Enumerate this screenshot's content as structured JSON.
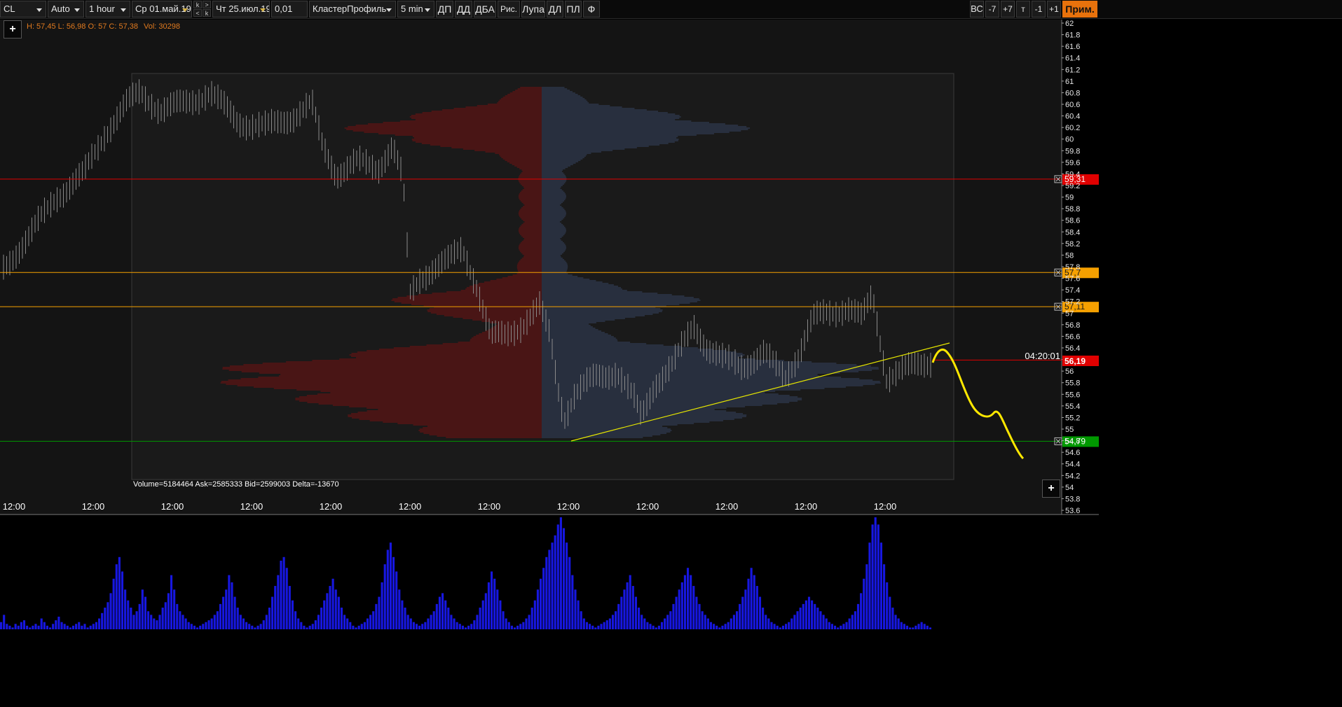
{
  "toolbar": {
    "symbol": "CL",
    "scale_mode": "Auto",
    "timeframe": "1 hour",
    "date_from": "Ср 01.май.19",
    "stepper_k1": "k",
    "stepper_gt": ">",
    "stepper_lt": "<",
    "stepper_k2": "k",
    "date_to": "Чт 25.июл.19",
    "tick_size": "0,01",
    "chart_type": "КластерПрофиль",
    "cluster_period": "5 min",
    "btn_dp": "ДП",
    "btn_dd": "ДД",
    "btn_dba": "ДБА",
    "btn_ris": "Рис.",
    "btn_lupa": "Лупа",
    "btn_dl": "ДЛ",
    "btn_pl": "ПЛ",
    "btn_f": "Ф",
    "btn_vs": "ВС",
    "btn_m7": "-7",
    "btn_p7": "+7",
    "btn_t": "т",
    "btn_m1": "-1",
    "btn_p1": "+1",
    "btn_prim": "Прим."
  },
  "info": {
    "ohlc": "H: 57,45  L: 56,98  O: 57  C: 57,38",
    "vol": "Vol: 30298",
    "profile_stats": "Volume=5184464  Ask=2585333  Bid=2599003  Delta=-13670"
  },
  "chart_data": {
    "type": "candlestick",
    "instrument": "CL",
    "timeframe": "1 hour",
    "y_axis": {
      "min": 53.6,
      "max": 62,
      "ticks": [
        "62",
        "61.8",
        "61.6",
        "61.4",
        "61.2",
        "61",
        "60.8",
        "60.6",
        "60.4",
        "60.2",
        "60",
        "59.8",
        "59.6",
        "59.4",
        "59.2",
        "59",
        "58.8",
        "58.6",
        "58.4",
        "58.2",
        "58",
        "57.8",
        "57.6",
        "57.4",
        "57.2",
        "57",
        "56.8",
        "56.6",
        "56.4",
        "56.2",
        "56",
        "55.8",
        "55.6",
        "55.4",
        "55.2",
        "55",
        "54.8",
        "54.6",
        "54.4",
        "54.2",
        "54",
        "53.8",
        "53.6"
      ]
    },
    "x_axis": {
      "ticks": [
        "12:00",
        "12:00",
        "12:00",
        "12:00",
        "12:00",
        "12:00",
        "12:00",
        "12:00",
        "12:00",
        "12:00",
        "12:00",
        "12:00"
      ]
    },
    "price_levels": [
      {
        "value": 59.31,
        "label": "59,31",
        "color": "#e00000"
      },
      {
        "value": 57.7,
        "label": "57,7",
        "color": "#f5a000"
      },
      {
        "value": 57.11,
        "label": "57,11",
        "color": "#f5a000"
      },
      {
        "value": 54.79,
        "label": "54,79",
        "color": "#009900"
      }
    ],
    "current_price": {
      "value": 56.19,
      "label": "56,19",
      "color": "#e00000"
    },
    "candle_countdown": "04:20:01",
    "price_path": [
      [
        0,
        57.7
      ],
      [
        40,
        58.3
      ],
      [
        80,
        59.0
      ],
      [
        120,
        59.4
      ],
      [
        150,
        60.1
      ],
      [
        180,
        60.6
      ],
      [
        200,
        60.8
      ],
      [
        230,
        60.5
      ],
      [
        260,
        60.6
      ],
      [
        300,
        60.8
      ],
      [
        340,
        60.3
      ],
      [
        380,
        60.2
      ],
      [
        420,
        60.4
      ],
      [
        445,
        60.6
      ],
      [
        460,
        59.9
      ],
      [
        480,
        59.4
      ],
      [
        510,
        59.6
      ],
      [
        540,
        59.5
      ],
      [
        560,
        59.9
      ],
      [
        575,
        59.3
      ],
      [
        585,
        57.3
      ],
      [
        600,
        57.6
      ],
      [
        620,
        57.8
      ],
      [
        640,
        57.9
      ],
      [
        660,
        58.1
      ],
      [
        680,
        57.5
      ],
      [
        700,
        56.6
      ],
      [
        720,
        56.6
      ],
      [
        745,
        56.8
      ],
      [
        770,
        57.1
      ],
      [
        785,
        56.6
      ],
      [
        795,
        55.8
      ],
      [
        805,
        55.2
      ],
      [
        820,
        55.6
      ],
      [
        850,
        55.9
      ],
      [
        880,
        56.0
      ],
      [
        905,
        55.5
      ],
      [
        915,
        55.2
      ],
      [
        935,
        55.8
      ],
      [
        960,
        56.1
      ],
      [
        990,
        56.8
      ],
      [
        1010,
        56.4
      ],
      [
        1030,
        56.2
      ],
      [
        1060,
        56.1
      ],
      [
        1090,
        56.3
      ],
      [
        1120,
        55.9
      ],
      [
        1140,
        56.3
      ],
      [
        1160,
        56.9
      ],
      [
        1180,
        57.0
      ],
      [
        1210,
        57.1
      ],
      [
        1230,
        56.9
      ],
      [
        1245,
        57.3
      ],
      [
        1255,
        56.6
      ],
      [
        1265,
        55.9
      ],
      [
        1285,
        56.0
      ],
      [
        1310,
        56.1
      ],
      [
        1330,
        56.19
      ]
    ],
    "volume_bars": [
      4,
      8,
      3,
      2,
      1,
      3,
      2,
      4,
      5,
      2,
      1,
      2,
      3,
      2,
      6,
      4,
      2,
      1,
      3,
      5,
      7,
      4,
      3,
      2,
      1,
      2,
      3,
      4,
      2,
      3,
      1,
      2,
      3,
      4,
      6,
      9,
      12,
      15,
      20,
      28,
      36,
      40,
      32,
      22,
      16,
      12,
      8,
      10,
      14,
      22,
      18,
      10,
      8,
      6,
      5,
      8,
      12,
      15,
      20,
      30,
      22,
      14,
      10,
      8,
      6,
      4,
      3,
      2,
      1,
      2,
      3,
      4,
      5,
      6,
      8,
      10,
      14,
      18,
      22,
      30,
      26,
      18,
      12,
      8,
      6,
      4,
      3,
      2,
      1,
      2,
      3,
      5,
      8,
      12,
      18,
      24,
      30,
      38,
      40,
      34,
      24,
      16,
      10,
      6,
      4,
      2,
      1,
      2,
      3,
      5,
      8,
      12,
      16,
      20,
      24,
      28,
      22,
      18,
      12,
      8,
      6,
      4,
      2,
      1,
      2,
      3,
      4,
      6,
      8,
      10,
      14,
      18,
      26,
      36,
      44,
      48,
      40,
      32,
      22,
      16,
      12,
      8,
      6,
      4,
      3,
      2,
      3,
      4,
      6,
      8,
      10,
      14,
      18,
      20,
      16,
      12,
      8,
      6,
      4,
      3,
      2,
      1,
      2,
      3,
      5,
      8,
      12,
      16,
      20,
      26,
      32,
      28,
      22,
      16,
      10,
      6,
      4,
      2,
      1,
      2,
      3,
      4,
      6,
      8,
      12,
      16,
      22,
      28,
      34,
      40,
      44,
      48,
      52,
      58,
      62,
      56,
      48,
      40,
      30,
      22,
      16,
      10,
      6,
      4,
      3,
      2,
      1,
      2,
      3,
      4,
      5,
      6,
      8,
      10,
      14,
      18,
      22,
      26,
      30,
      24,
      18,
      12,
      8,
      6,
      4,
      3,
      2,
      1,
      2,
      4,
      6,
      8,
      10,
      14,
      18,
      22,
      26,
      30,
      34,
      30,
      24,
      18,
      14,
      10,
      8,
      6,
      4,
      3,
      2,
      1,
      2,
      3,
      4,
      6,
      8,
      10,
      14,
      18,
      22,
      28,
      34,
      30,
      24,
      18,
      12,
      8,
      6,
      4,
      3,
      2,
      1,
      2,
      3,
      4,
      6,
      8,
      10,
      12,
      14,
      16,
      18,
      16,
      14,
      12,
      10,
      8,
      6,
      4,
      3,
      2,
      1,
      2,
      3,
      4,
      6,
      8,
      10,
      14,
      20,
      28,
      36,
      48,
      58,
      62,
      58,
      48,
      36,
      26,
      18,
      12,
      8,
      6,
      4,
      3,
      2,
      1,
      1,
      2,
      3,
      4,
      3,
      2,
      1
    ]
  }
}
